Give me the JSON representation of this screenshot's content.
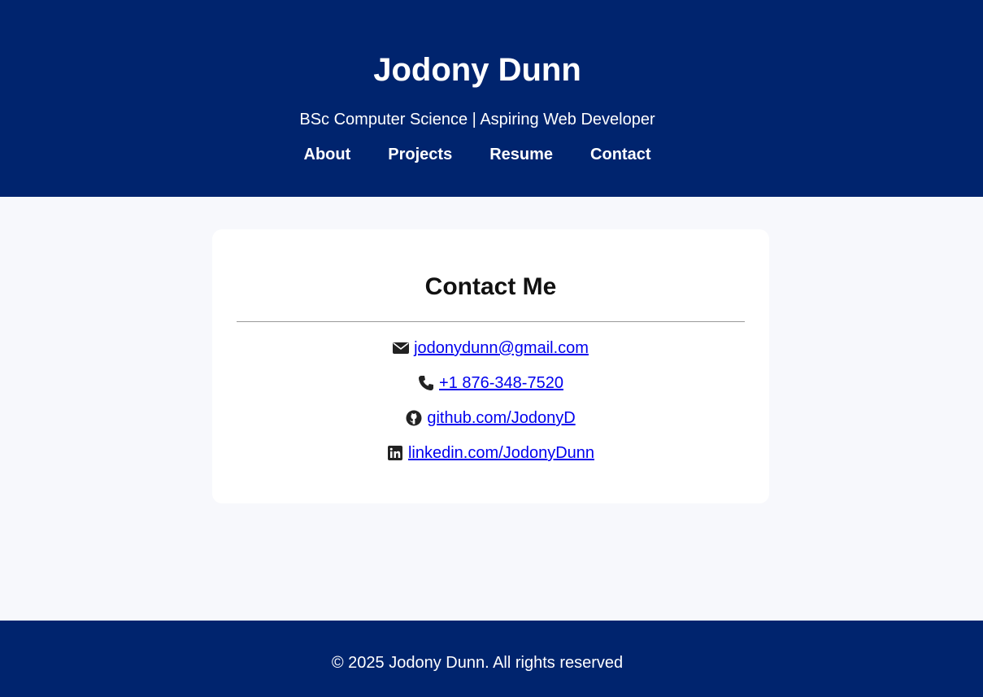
{
  "header": {
    "title": "Jodony Dunn",
    "subtitle": "BSc Computer Science | Aspiring Web Developer",
    "nav": [
      "About",
      "Projects",
      "Resume",
      "Contact"
    ]
  },
  "contact": {
    "title": "Contact Me",
    "email": "jodonydunn@gmail.com",
    "phone": "+1 876-348-7520",
    "github": "github.com/JodonyD",
    "linkedin": "linkedin.com/JodonyDunn"
  },
  "footer": {
    "text": "© 2025 Jodony Dunn. All rights reserved"
  },
  "icons": {
    "email": "envelope-icon",
    "phone": "phone-icon",
    "github": "github-icon",
    "linkedin": "linkedin-icon"
  },
  "colors": {
    "brand": "#00246e",
    "background": "#f7f8fc",
    "link": "#0000ee"
  }
}
